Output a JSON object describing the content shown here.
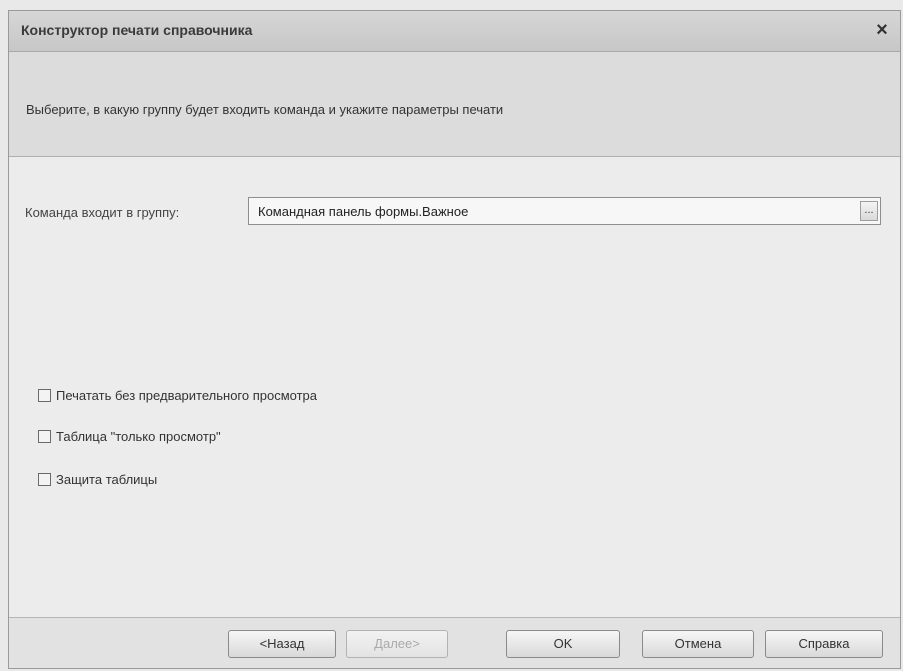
{
  "window": {
    "title": "Конструктор печати справочника",
    "close_symbol": "×"
  },
  "info": {
    "text": "Выберите, в какую группу будет входить команда и укажите параметры печати"
  },
  "group": {
    "label": "Команда входит в группу:",
    "value": "Командная панель формы.Важное",
    "select_button": "..."
  },
  "options": [
    {
      "label": "Печатать без предварительного просмотра",
      "checked": false
    },
    {
      "label": "Таблица \"только просмотр\"",
      "checked": false
    },
    {
      "label": "Защита таблицы",
      "checked": false
    }
  ],
  "buttons": {
    "back": "<Назад",
    "next": "Далее>",
    "ok": "OK",
    "cancel": "Отмена",
    "help": "Справка"
  },
  "colors": {
    "title_bar": "#c9c9c9",
    "dialog_bg": "#ececec",
    "info_bg": "#dcdcdc",
    "disabled_text": "#a9a9a9"
  }
}
